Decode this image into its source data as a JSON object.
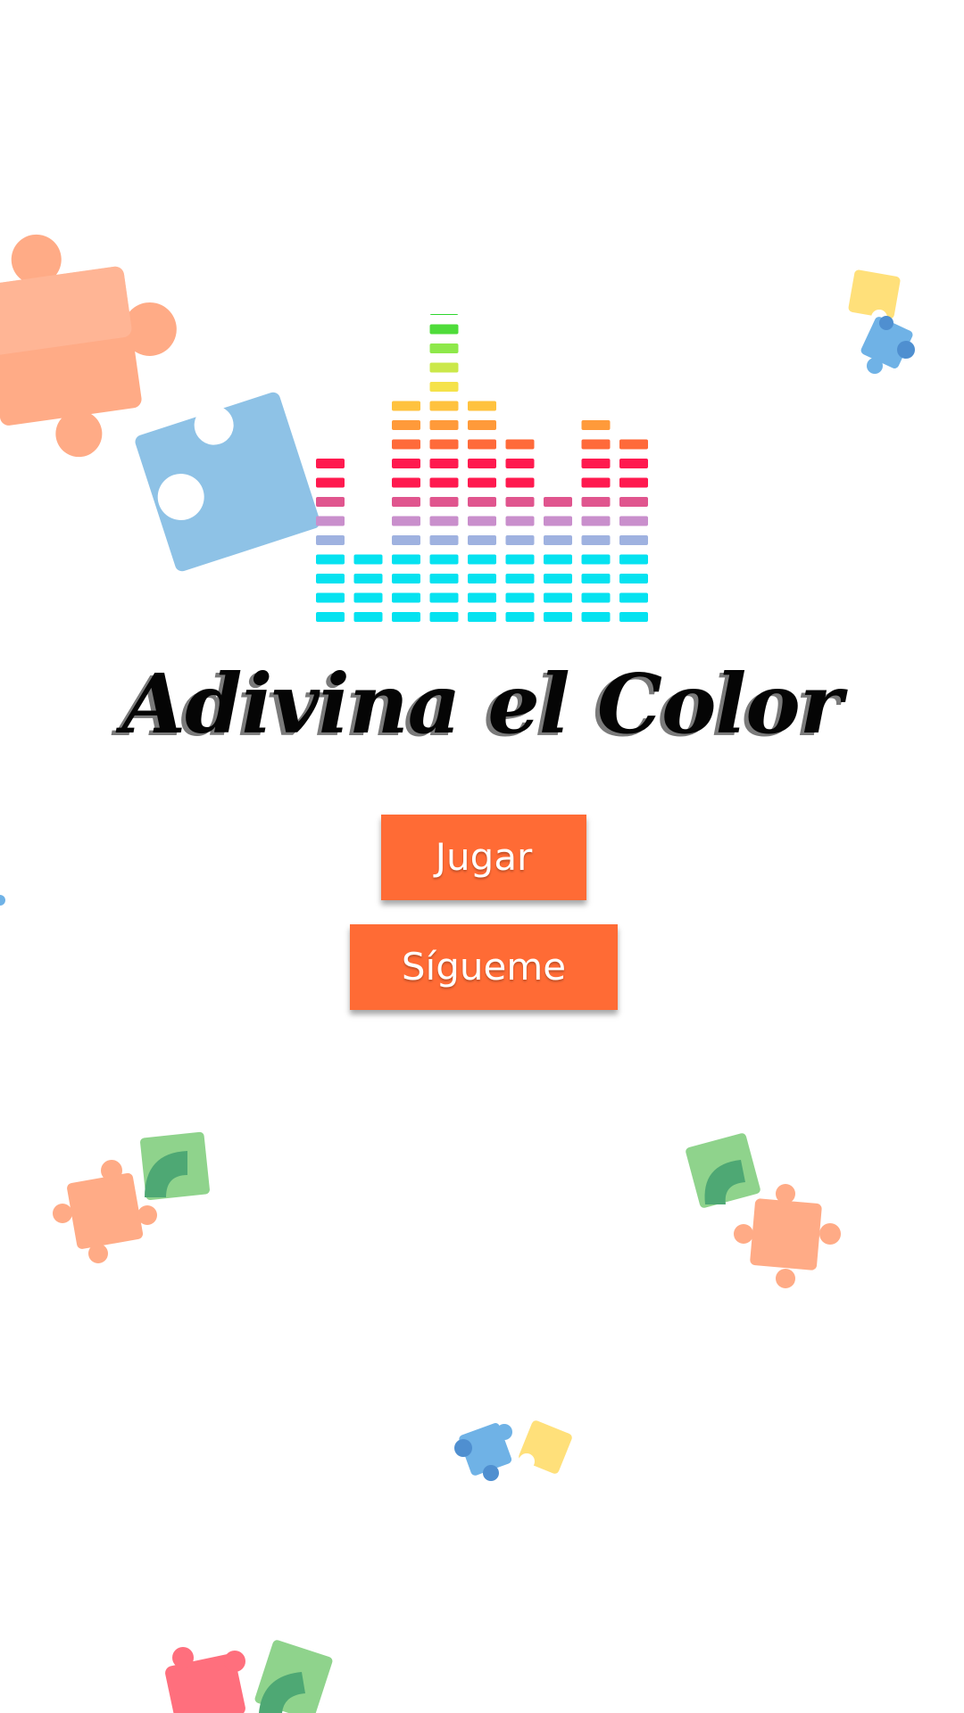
{
  "app": {
    "title": "Adivina el Color"
  },
  "buttons": {
    "play_label": "Jugar",
    "follow_label": "Sígueme"
  },
  "colors": {
    "button_bg": "#ff6b35",
    "button_text": "#ffffff",
    "title_text": "#050505",
    "title_shadow": "#7a7a7a",
    "background": "#ffffff",
    "puzzle_orange": "#ffab86",
    "puzzle_blue": "#8ec2e6",
    "puzzle_green": "#8fd38c",
    "puzzle_yellow": "#ffe07a",
    "puzzle_red": "#ff6f7d",
    "equalizer_rows": [
      "#ff1a4f",
      "#e0558e",
      "#c98fcc",
      "#9fb2e0",
      "#05e2f0"
    ]
  },
  "icons": {
    "logo": "equalizer-bars-icon",
    "decoration": "puzzle-piece-icon"
  }
}
